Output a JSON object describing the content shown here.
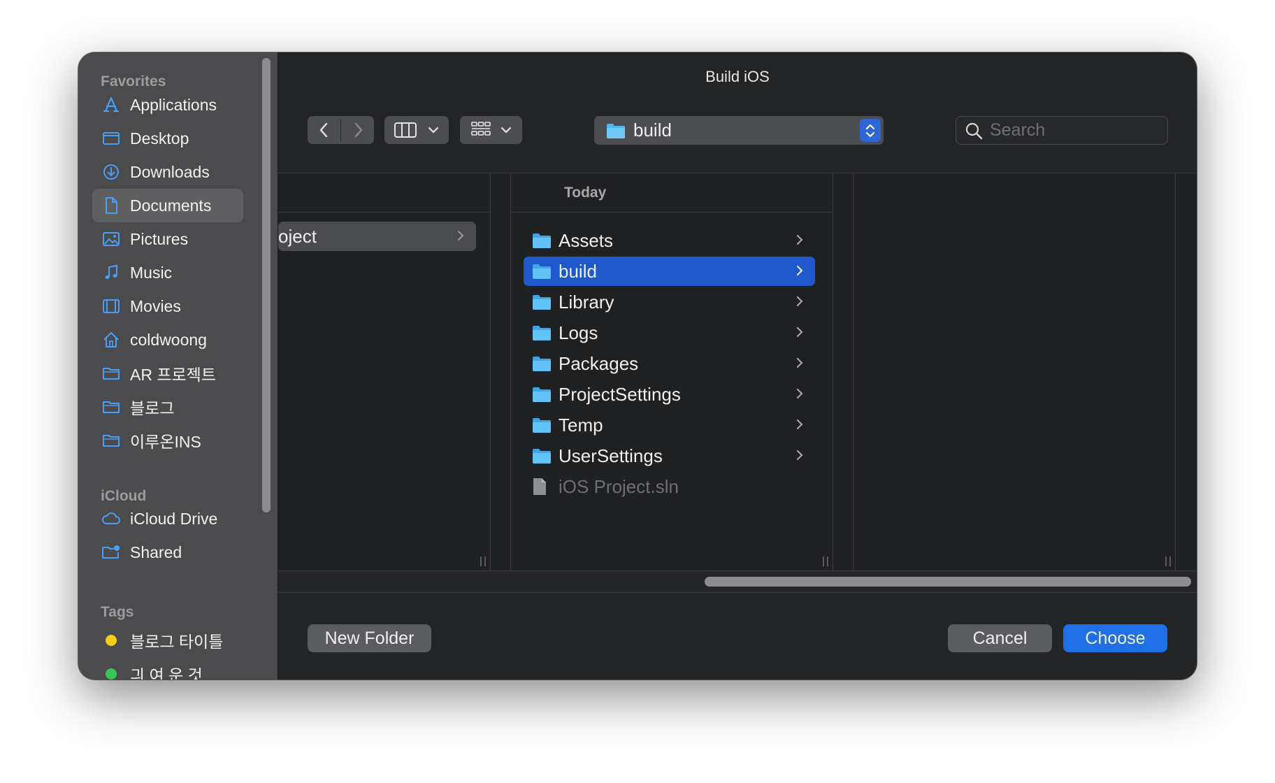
{
  "window": {
    "title": "Build iOS"
  },
  "sidebar": {
    "favorites_heading": "Favorites",
    "favorites": [
      {
        "label": "Applications",
        "icon": "applications-icon"
      },
      {
        "label": "Desktop",
        "icon": "desktop-icon"
      },
      {
        "label": "Downloads",
        "icon": "downloads-icon"
      },
      {
        "label": "Documents",
        "icon": "documents-icon",
        "selected": true
      },
      {
        "label": "Pictures",
        "icon": "pictures-icon"
      },
      {
        "label": "Music",
        "icon": "music-icon"
      },
      {
        "label": "Movies",
        "icon": "movies-icon"
      },
      {
        "label": "coldwoong",
        "icon": "home-icon"
      },
      {
        "label": "AR 프로젝트",
        "icon": "folder-icon"
      },
      {
        "label": "블로그",
        "icon": "folder-icon"
      },
      {
        "label": "이루온INS",
        "icon": "folder-icon"
      }
    ],
    "icloud_heading": "iCloud",
    "icloud": [
      {
        "label": "iCloud Drive",
        "icon": "cloud-icon"
      },
      {
        "label": "Shared",
        "icon": "shared-folder-icon"
      }
    ],
    "tags_heading": "Tags",
    "tags": [
      {
        "label": "블로그 타이틀",
        "color": "#f5d018"
      },
      {
        "label": "긔 여 운 것",
        "color": "#34c759"
      }
    ]
  },
  "toolbar": {
    "view_mode": "columns",
    "path_popup_label": "build",
    "search_placeholder": "Search"
  },
  "columns": {
    "col1": {
      "header": "",
      "items": [
        {
          "label": "oject",
          "kind": "folder-partial"
        }
      ]
    },
    "col2": {
      "header": "Today",
      "items": [
        {
          "label": "Assets",
          "kind": "folder"
        },
        {
          "label": "build",
          "kind": "folder",
          "selected": true
        },
        {
          "label": "Library",
          "kind": "folder"
        },
        {
          "label": "Logs",
          "kind": "folder"
        },
        {
          "label": "Packages",
          "kind": "folder"
        },
        {
          "label": "ProjectSettings",
          "kind": "folder"
        },
        {
          "label": "Temp",
          "kind": "folder"
        },
        {
          "label": "UserSettings",
          "kind": "folder"
        },
        {
          "label": "iOS Project.sln",
          "kind": "file",
          "disabled": true
        }
      ]
    }
  },
  "footer": {
    "new_folder_label": "New Folder",
    "cancel_label": "Cancel",
    "choose_label": "Choose"
  },
  "colors": {
    "accent": "#1f57cd",
    "folder": "#4fb8f0",
    "sidebar_icon": "#4a9ff5"
  }
}
